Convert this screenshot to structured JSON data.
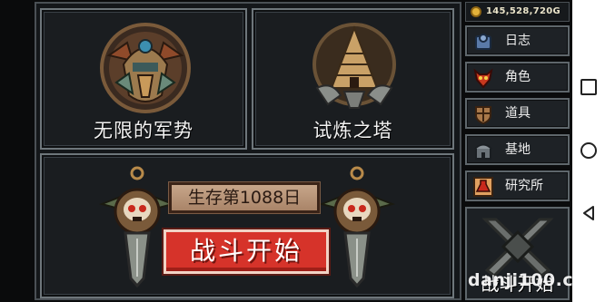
{
  "modes": {
    "war_title": "无限的军势",
    "tower_title": "试炼之塔"
  },
  "survival": {
    "day_label": "生存第1088日",
    "start_label": "战斗开始"
  },
  "currency": {
    "gold": "145,528,720G",
    "icon": "gold-coin-icon"
  },
  "sidebar": {
    "items": [
      {
        "label": "日志",
        "icon": "journal-icon"
      },
      {
        "label": "角色",
        "icon": "demon-mask-icon"
      },
      {
        "label": "道具",
        "icon": "shield-icon"
      },
      {
        "label": "基地",
        "icon": "base-icon"
      },
      {
        "label": "研究所",
        "icon": "potion-icon"
      }
    ],
    "battle_label": "战斗开始"
  },
  "watermark": "danji100.com",
  "colors": {
    "start_red": "#d6332a",
    "banner_tan": "#b89274",
    "frame_gray": "#6e767b",
    "gold": "#e4b23a"
  }
}
